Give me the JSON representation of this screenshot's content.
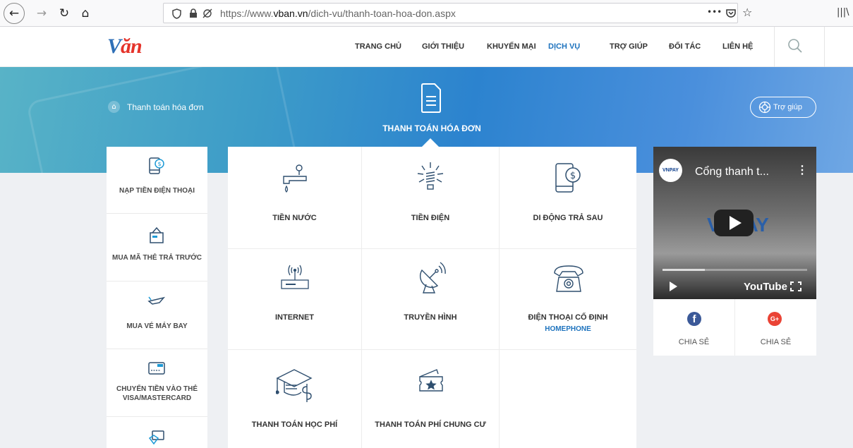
{
  "browser": {
    "back": "←",
    "forward": "→",
    "reload": "↻",
    "home": "⌂",
    "url_prefix": "https://www.",
    "url_domain": "vban.vn",
    "url_path": "/dich-vu/thanh-toan-hoa-don.aspx",
    "more": "•••",
    "pocket": "◫",
    "bookmark": "☆",
    "library": "|||\\"
  },
  "header": {
    "logo_v": "V",
    "logo_rest": "ăn",
    "nav": [
      {
        "label": "TRANG CHỦ",
        "active": false
      },
      {
        "label": "GIỚI THIỆU",
        "active": false
      },
      {
        "label": "KHUYẾN MẠI",
        "active": false
      },
      {
        "label": "DỊCH VỤ",
        "active": true
      },
      {
        "label": "TRỢ GIÚP",
        "active": false
      },
      {
        "label": "ĐỐI TÁC",
        "active": false
      },
      {
        "label": "LIÊN HỆ",
        "active": false
      }
    ]
  },
  "banner": {
    "breadcrumb": "Thanh toán hóa đơn",
    "title": "THANH TOÁN HÓA ĐƠN",
    "help": "Trợ giúp"
  },
  "left_menu": [
    {
      "label": "NẠP TIỀN ĐIỆN THOẠI",
      "icon": "phone-dollar-icon"
    },
    {
      "label": "MUA MÃ THẺ TRẢ TRƯỚC",
      "icon": "prepaid-card-icon"
    },
    {
      "label": "MUA VÉ MÁY BAY",
      "icon": "airplane-icon"
    },
    {
      "label": "CHUYỂN TIỀN VÀO THẺ VISA/MASTERCARD",
      "icon": "visa-card-icon"
    },
    {
      "label": "",
      "icon": "card-payment-icon"
    }
  ],
  "services": [
    {
      "label": "TIỀN NƯỚC",
      "sub": "",
      "icon": "water-tap-icon"
    },
    {
      "label": "TIỀN ĐIỆN",
      "sub": "",
      "icon": "light-bulb-icon"
    },
    {
      "label": "DI ĐỘNG TRẢ SAU",
      "sub": "",
      "icon": "mobile-dollar-icon"
    },
    {
      "label": "INTERNET",
      "sub": "",
      "icon": "router-icon"
    },
    {
      "label": "TRUYỀN HÌNH",
      "sub": "",
      "icon": "satellite-dish-icon"
    },
    {
      "label": "ĐIỆN THOẠI CỐ ĐỊNH",
      "sub": "HOMEPHONE",
      "icon": "telephone-icon"
    },
    {
      "label": "THANH TOÁN HỌC PHÍ",
      "sub": "",
      "icon": "graduation-cap-icon"
    },
    {
      "label": "THANH TOÁN PHÍ CHUNG CƯ",
      "sub": "",
      "icon": "ticket-star-icon"
    }
  ],
  "video": {
    "channel": "VNPAY",
    "title": "Cổng thanh t...",
    "dots": "⋮",
    "brand": "VNPAY",
    "youtube": "YouTube"
  },
  "share": {
    "facebook_label": "CHIA SẺ",
    "google_label": "CHIA SẺ",
    "fb_glyph": "f",
    "gp_glyph": "G+"
  }
}
